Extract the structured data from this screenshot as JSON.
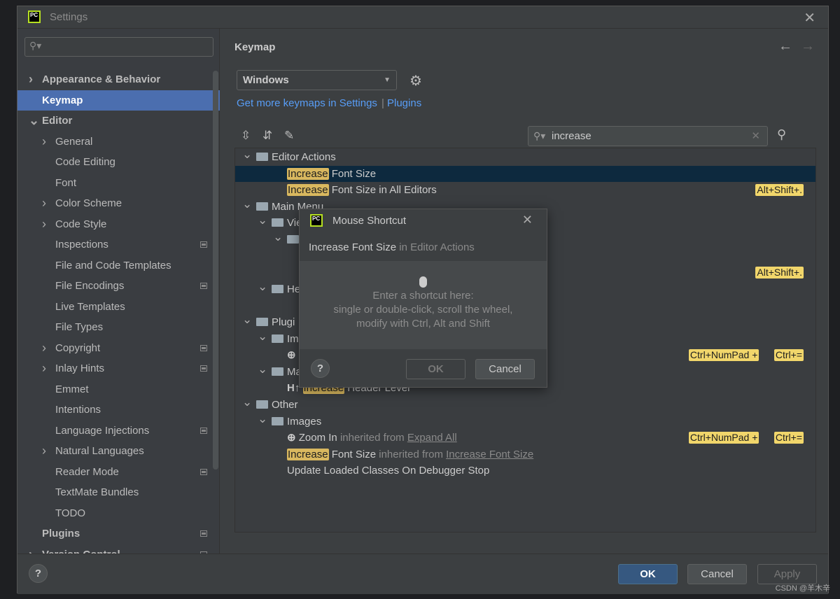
{
  "window": {
    "title": "Settings"
  },
  "sidebar": {
    "search_placeholder": "",
    "items": [
      {
        "label": "Appearance & Behavior",
        "level": 0,
        "arrow": "right",
        "bold": true
      },
      {
        "label": "Keymap",
        "level": 0,
        "arrow": "",
        "bold": true,
        "selected": true
      },
      {
        "label": "Editor",
        "level": 0,
        "arrow": "down",
        "bold": true
      },
      {
        "label": "General",
        "level": 1,
        "arrow": "right"
      },
      {
        "label": "Code Editing",
        "level": 1,
        "arrow": ""
      },
      {
        "label": "Font",
        "level": 1,
        "arrow": ""
      },
      {
        "label": "Color Scheme",
        "level": 1,
        "arrow": "right"
      },
      {
        "label": "Code Style",
        "level": 1,
        "arrow": "right"
      },
      {
        "label": "Inspections",
        "level": 1,
        "arrow": "",
        "mod": true
      },
      {
        "label": "File and Code Templates",
        "level": 1,
        "arrow": ""
      },
      {
        "label": "File Encodings",
        "level": 1,
        "arrow": "",
        "mod": true
      },
      {
        "label": "Live Templates",
        "level": 1,
        "arrow": ""
      },
      {
        "label": "File Types",
        "level": 1,
        "arrow": ""
      },
      {
        "label": "Copyright",
        "level": 1,
        "arrow": "right",
        "mod": true
      },
      {
        "label": "Inlay Hints",
        "level": 1,
        "arrow": "right",
        "mod": true
      },
      {
        "label": "Emmet",
        "level": 1,
        "arrow": ""
      },
      {
        "label": "Intentions",
        "level": 1,
        "arrow": ""
      },
      {
        "label": "Language Injections",
        "level": 1,
        "arrow": "",
        "mod": true
      },
      {
        "label": "Natural Languages",
        "level": 1,
        "arrow": "right"
      },
      {
        "label": "Reader Mode",
        "level": 1,
        "arrow": "",
        "mod": true
      },
      {
        "label": "TextMate Bundles",
        "level": 1,
        "arrow": ""
      },
      {
        "label": "TODO",
        "level": 1,
        "arrow": ""
      },
      {
        "label": "Plugins",
        "level": 0,
        "arrow": "",
        "bold": true,
        "mod": true
      },
      {
        "label": "Version Control",
        "level": 0,
        "arrow": "right",
        "bold": true,
        "mod": true
      }
    ]
  },
  "main": {
    "heading": "Keymap",
    "keymap_value": "Windows",
    "link1": "Get more keymaps in Settings",
    "sep": "|",
    "link2": "Plugins",
    "search_value": "increase"
  },
  "tree": [
    {
      "level": 0,
      "arrow": "down",
      "folder": true,
      "parts": [
        [
          "Editor Actions",
          ""
        ]
      ]
    },
    {
      "level": 2,
      "selected": true,
      "parts": [
        [
          "Increase",
          "hl"
        ],
        [
          " Font Size",
          ""
        ]
      ]
    },
    {
      "level": 2,
      "parts": [
        [
          "Increase",
          "hl"
        ],
        [
          " Font Size in All Editors",
          ""
        ]
      ],
      "shortcuts": [
        "Alt+Shift+."
      ]
    },
    {
      "level": 0,
      "arrow": "down",
      "folder": true,
      "parts": [
        [
          "Main Menu",
          ""
        ]
      ]
    },
    {
      "level": 1,
      "arrow": "down",
      "folder": true,
      "parts": [
        [
          "Vie",
          ""
        ]
      ]
    },
    {
      "level": 2,
      "arrow": "down",
      "folder": true,
      "parts": []
    },
    {
      "level": 2,
      "parts": []
    },
    {
      "level": 2,
      "parts": [],
      "shortcuts": [
        "Alt+Shift+."
      ]
    },
    {
      "level": 1,
      "arrow": "down",
      "folder": true,
      "parts": [
        [
          "He",
          ""
        ]
      ]
    },
    {
      "level": 2,
      "parts": []
    },
    {
      "level": 0,
      "arrow": "down",
      "folder": true,
      "parts": [
        [
          "Plugi",
          ""
        ]
      ]
    },
    {
      "level": 1,
      "arrow": "down",
      "folder": true,
      "parts": [
        [
          "Im",
          ""
        ]
      ]
    },
    {
      "level": 2,
      "icon": "⊕",
      "parts": [],
      "shortcuts": [
        "Ctrl+NumPad +",
        "Ctrl+="
      ]
    },
    {
      "level": 1,
      "arrow": "down",
      "folder": true,
      "parts": [
        [
          "Markdown",
          ""
        ]
      ]
    },
    {
      "level": 2,
      "icon": "H↑",
      "parts": [
        [
          "Increase",
          "hl"
        ],
        [
          " Header Level",
          ""
        ]
      ]
    },
    {
      "level": 0,
      "arrow": "down",
      "folder": true,
      "parts": [
        [
          "Other",
          ""
        ]
      ]
    },
    {
      "level": 1,
      "arrow": "down",
      "folder": true,
      "parts": [
        [
          "Images",
          ""
        ]
      ]
    },
    {
      "level": 2,
      "icon": "⊕",
      "parts": [
        [
          "Zoom In",
          ""
        ],
        [
          " inherited from ",
          "gray"
        ],
        [
          "Expand All",
          "u"
        ]
      ],
      "shortcuts": [
        "Ctrl+NumPad +",
        "Ctrl+="
      ]
    },
    {
      "level": 2,
      "parts": [
        [
          "Increase",
          "hl"
        ],
        [
          " Font Size",
          ""
        ],
        [
          " inherited from ",
          "gray"
        ],
        [
          "Increase Font Size",
          "u"
        ]
      ]
    },
    {
      "level": 2,
      "parts": [
        [
          "Update Loaded Classes On Debugger Stop",
          ""
        ]
      ]
    }
  ],
  "dialog": {
    "title": "Mouse Shortcut",
    "action": "Increase Font Size",
    "context": "in Editor Actions",
    "line1": "Enter a shortcut here:",
    "line2": "single or double-click, scroll the wheel,",
    "line3": "modify with Ctrl, Alt and Shift",
    "help": "?",
    "ok": "OK",
    "cancel": "Cancel"
  },
  "footer": {
    "help": "?",
    "ok": "OK",
    "cancel": "Cancel",
    "apply": "Apply"
  },
  "watermark": "CSDN @羊木辛"
}
